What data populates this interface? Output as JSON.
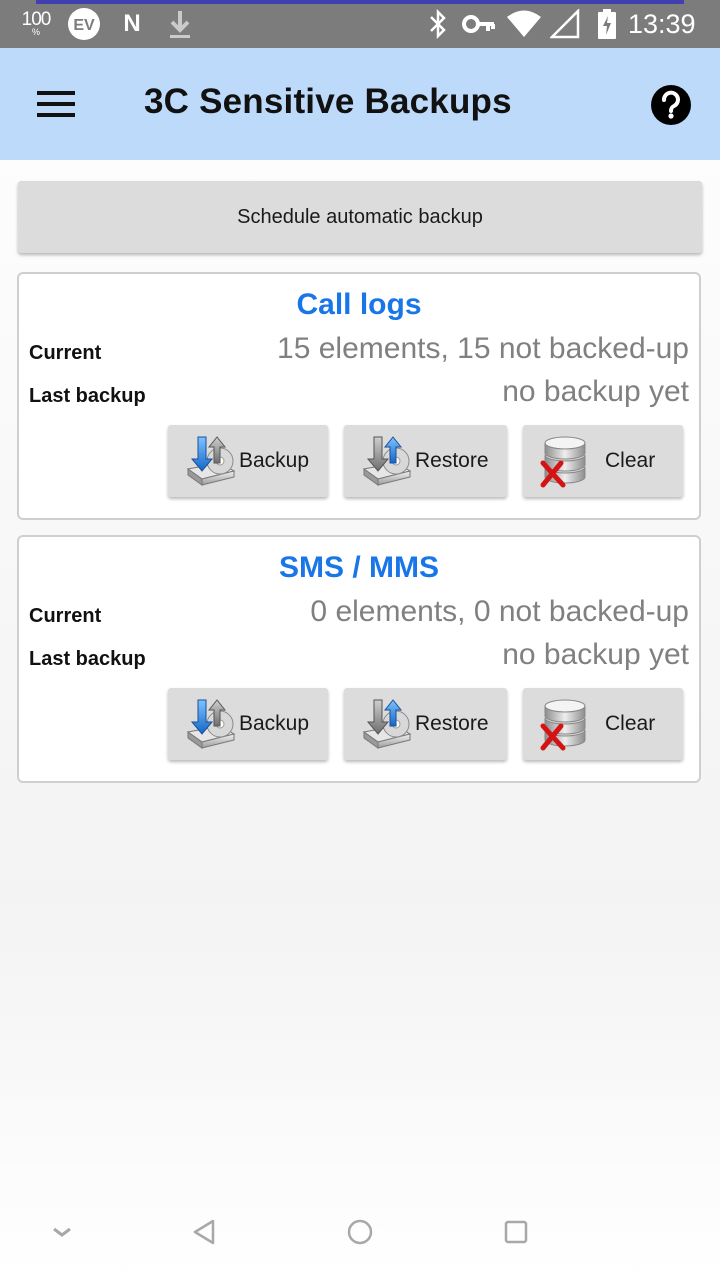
{
  "status_bar": {
    "battery_level": "100",
    "battery_sub": "%",
    "ev_label": "EV",
    "n_label": "N",
    "time": "13:39"
  },
  "app_bar": {
    "title": "3C Sensitive Backups"
  },
  "schedule": {
    "label": "Schedule automatic backup"
  },
  "cards": [
    {
      "title": "Call logs",
      "current_label": "Current",
      "current_value": "15 elements, 15 not backed-up",
      "last_backup_label": "Last backup",
      "last_backup_value": "no backup yet",
      "buttons": {
        "backup": "Backup",
        "restore": "Restore",
        "clear": "Clear"
      }
    },
    {
      "title": "SMS / MMS",
      "current_label": "Current",
      "current_value": "0 elements, 0 not backed-up",
      "last_backup_label": "Last backup",
      "last_backup_value": "no backup yet",
      "buttons": {
        "backup": "Backup",
        "restore": "Restore",
        "clear": "Clear"
      }
    }
  ],
  "icons": {
    "menu": "hamburger-menu-icon",
    "help": "help-circle-icon",
    "backup": "backup-drive-icon",
    "restore": "restore-drive-icon",
    "clear": "clear-database-icon"
  },
  "colors": {
    "app_bar": "#bedafa",
    "card_title": "#1976e8",
    "status_bar": "#7c7c7c"
  }
}
